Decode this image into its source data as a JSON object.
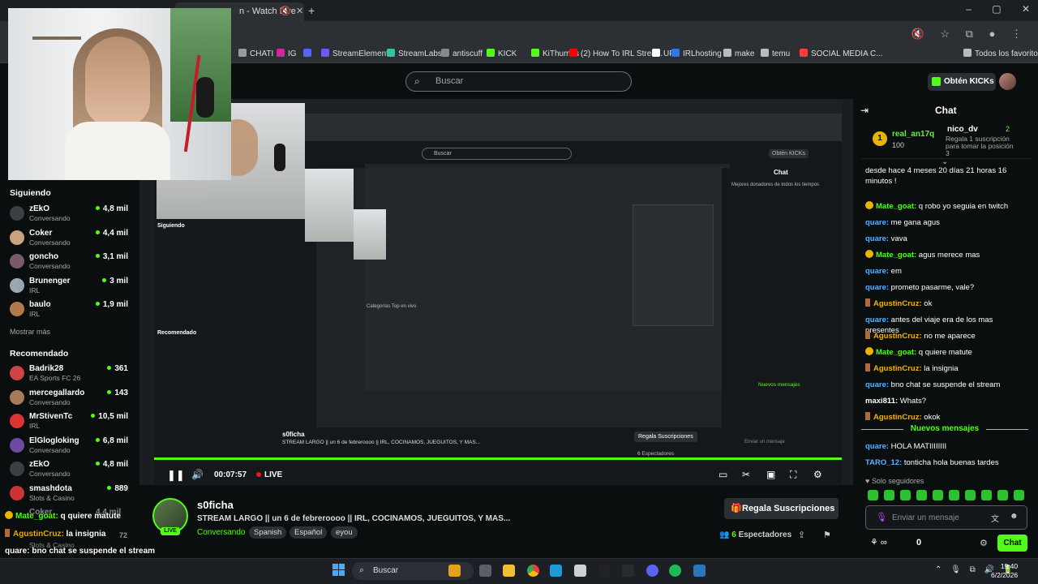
{
  "browser": {
    "tab_title": "n - Watch Live",
    "new_tab": "+",
    "window_controls": "– ▢ ✕",
    "bookmarks": [
      {
        "label": "CHATI",
        "color": "#9a9a9a"
      },
      {
        "label": "IG",
        "color": "#d6249f"
      },
      {
        "label": "",
        "color": "#5865f2"
      },
      {
        "label": "StreamElements",
        "color": "#6a5bff"
      },
      {
        "label": "StreamLabs",
        "color": "#31c3a2"
      },
      {
        "label": "antiscuff",
        "color": "#888888"
      },
      {
        "label": "KICK",
        "color": "#53fc18"
      },
      {
        "label": "KiThumbs",
        "color": "#53fc18"
      },
      {
        "label": "(2) How To IRL Strea...",
        "color": "#ff0000"
      },
      {
        "label": "UP",
        "color": "#ffffff"
      },
      {
        "label": "IRLhosting",
        "color": "#2c7be5"
      },
      {
        "label": "make",
        "color": "#bbbbbb"
      },
      {
        "label": "temu",
        "color": "#bbbbbb"
      },
      {
        "label": "SOCIAL MEDIA C...",
        "color": "#ff3b3b"
      },
      {
        "label": "Todos los favoritos",
        "color": "#bbbbbb"
      }
    ]
  },
  "header": {
    "search_placeholder": "Buscar",
    "kicks_button": "Obtén KICKs"
  },
  "sidebar": {
    "following_title": "Siguiendo",
    "following": [
      {
        "name": "zEkO",
        "sub": "Conversando",
        "viewers": "4,8 mil",
        "color": "#3a3f44"
      },
      {
        "name": "Coker",
        "sub": "Conversando",
        "viewers": "4,4 mil",
        "color": "#c9a27e"
      },
      {
        "name": "goncho",
        "sub": "Conversando",
        "viewers": "3,1 mil",
        "color": "#7a5a6a"
      },
      {
        "name": "Brunenger",
        "sub": "IRL",
        "viewers": "3 mil",
        "color": "#9aa6b2"
      },
      {
        "name": "baulo",
        "sub": "IRL",
        "viewers": "1,9 mil",
        "color": "#b07a4a"
      }
    ],
    "show_more": "Mostrar más",
    "recommended_title": "Recomendado",
    "recommended": [
      {
        "name": "Badrik28",
        "sub": "EA Sports FC 26",
        "viewers": "361",
        "color": "#c44"
      },
      {
        "name": "mercegallardo",
        "sub": "Conversando",
        "viewers": "143",
        "color": "#a87a5a"
      },
      {
        "name": "MrStivenTc",
        "sub": "IRL",
        "viewers": "10,5 mil",
        "color": "#d33"
      },
      {
        "name": "ElGlogloking",
        "sub": "Conversando",
        "viewers": "6,8 mil",
        "color": "#6b4aa0"
      },
      {
        "name": "zEkO",
        "sub": "Conversando",
        "viewers": "4,8 mil",
        "color": "#3a3f44"
      },
      {
        "name": "smashdota",
        "sub": "Slots & Casino",
        "viewers": "889",
        "color": "#c33"
      }
    ],
    "partial_name": "Coker",
    "partial_viewers": "4,4 mil",
    "partial_sub": "Slots & Casino",
    "partial_views_2": "72"
  },
  "player": {
    "time": "00:07:57",
    "live_label": "LIVE",
    "overlay_chat": [
      {
        "badge": "1",
        "user": "Mate_goat:",
        "text": " q quiere matute",
        "type": "gold"
      },
      {
        "badge": "s",
        "user": "AgustinCruz:",
        "text": " la insignia",
        "type": "sub"
      },
      {
        "badge": "",
        "user": "quare:",
        "text": " bno chat se suspende el stream",
        "type": "plain"
      },
      {
        "badge": "",
        "user": "maxi811:",
        "text": " Whats?",
        "type": "plain"
      }
    ],
    "inner_texts": {
      "inner_search": "Buscar",
      "inner_chat": "Chat",
      "inner_kicks": "Obtén KICKs",
      "inner_streamer": "s0ficha",
      "inner_title": "STREAM LARGO || un 6 de febreroooo || IRL, COCINAMOS, JUEGUITOS, Y MAS...",
      "inner_sub_btn": "Regala Suscripciones",
      "inner_spect": "6 Espectadores",
      "inner_following": "Siguiendo",
      "inner_recommended": "Recomendado",
      "inner_top": "Mejores donadores de todos los tiempos",
      "inner_new": "Nuevos mensajes",
      "inner_categories": "Categorías Top en vivo",
      "inner_mensaje": "Enviar un mensaje"
    }
  },
  "stream": {
    "live_badge": "LIVE",
    "streamer": "s0ficha",
    "title": "STREAM LARGO || un 6 de febreroooo || IRL, COCINAMOS, JUEGUITOS, Y MAS...",
    "category": "Conversando",
    "tags": [
      "Spanish",
      "Español",
      "eyou"
    ],
    "sub_button": "Regala Suscripciones",
    "viewers_count": "6",
    "viewers_label": "Espectadores"
  },
  "chat": {
    "title": "Chat",
    "top_gifters": [
      {
        "rank": "1",
        "name": "real_an17q",
        "count": "100"
      },
      {
        "name": "nico_dv",
        "count": "2",
        "desc": "Regala 1 suscripción para tomar la posición 3"
      }
    ],
    "messages": [
      {
        "user": "",
        "text": "desde hace 4 meses 20 días 21 horas 16 minutos !",
        "color": "#ffffff",
        "badge": ""
      },
      {
        "user": "Mate_goat:",
        "text": " q robo yo seguia en twitch",
        "color": "#53fc18",
        "badge": "gold"
      },
      {
        "user": "quare:",
        "text": " me gana agus",
        "color": "#5ab3ff",
        "badge": ""
      },
      {
        "user": "quare:",
        "text": " vava",
        "color": "#5ab3ff",
        "badge": ""
      },
      {
        "user": "Mate_goat:",
        "text": " agus merece mas",
        "color": "#53fc18",
        "badge": "gold"
      },
      {
        "user": "quare:",
        "text": " em",
        "color": "#5ab3ff",
        "badge": ""
      },
      {
        "user": "quare:",
        "text": " prometo pasarme, vale?",
        "color": "#5ab3ff",
        "badge": ""
      },
      {
        "user": "AgustinCruz:",
        "text": " ok",
        "color": "#f0b400",
        "badge": "sub"
      },
      {
        "user": "quare:",
        "text": " antes del viaje era de los mas presentes",
        "color": "#5ab3ff",
        "badge": ""
      },
      {
        "user": "AgustinCruz:",
        "text": " no me aparece",
        "color": "#f0b400",
        "badge": "sub"
      },
      {
        "user": "Mate_goat:",
        "text": " q quiere matute",
        "color": "#53fc18",
        "badge": "gold"
      },
      {
        "user": "AgustinCruz:",
        "text": " la insignia",
        "color": "#f0b400",
        "badge": "sub"
      },
      {
        "user": "quare:",
        "text": " bno chat se suspende el stream",
        "color": "#5ab3ff",
        "badge": ""
      },
      {
        "user": "maxi811:",
        "text": " Whats?",
        "color": "#ffffff",
        "badge": ""
      },
      {
        "user": "AgustinCruz:",
        "text": " okok",
        "color": "#f0b400",
        "badge": "sub"
      }
    ],
    "new_messages": "Nuevos mensajes",
    "after_messages": [
      {
        "user": "quare:",
        "text": " HOLA MATIIIIIIII",
        "color": "#5ab3ff"
      },
      {
        "user": "TARO_12:",
        "text": " tonticha hola buenas tardes",
        "color": "#5ab3ff"
      }
    ],
    "followers_only": "Solo seguidores",
    "input_placeholder": "Enviar un mensaje",
    "points": "0",
    "chat_button": "Chat"
  },
  "taskbar": {
    "search": "Buscar",
    "time": "19:40",
    "date": "6/2/2026"
  }
}
